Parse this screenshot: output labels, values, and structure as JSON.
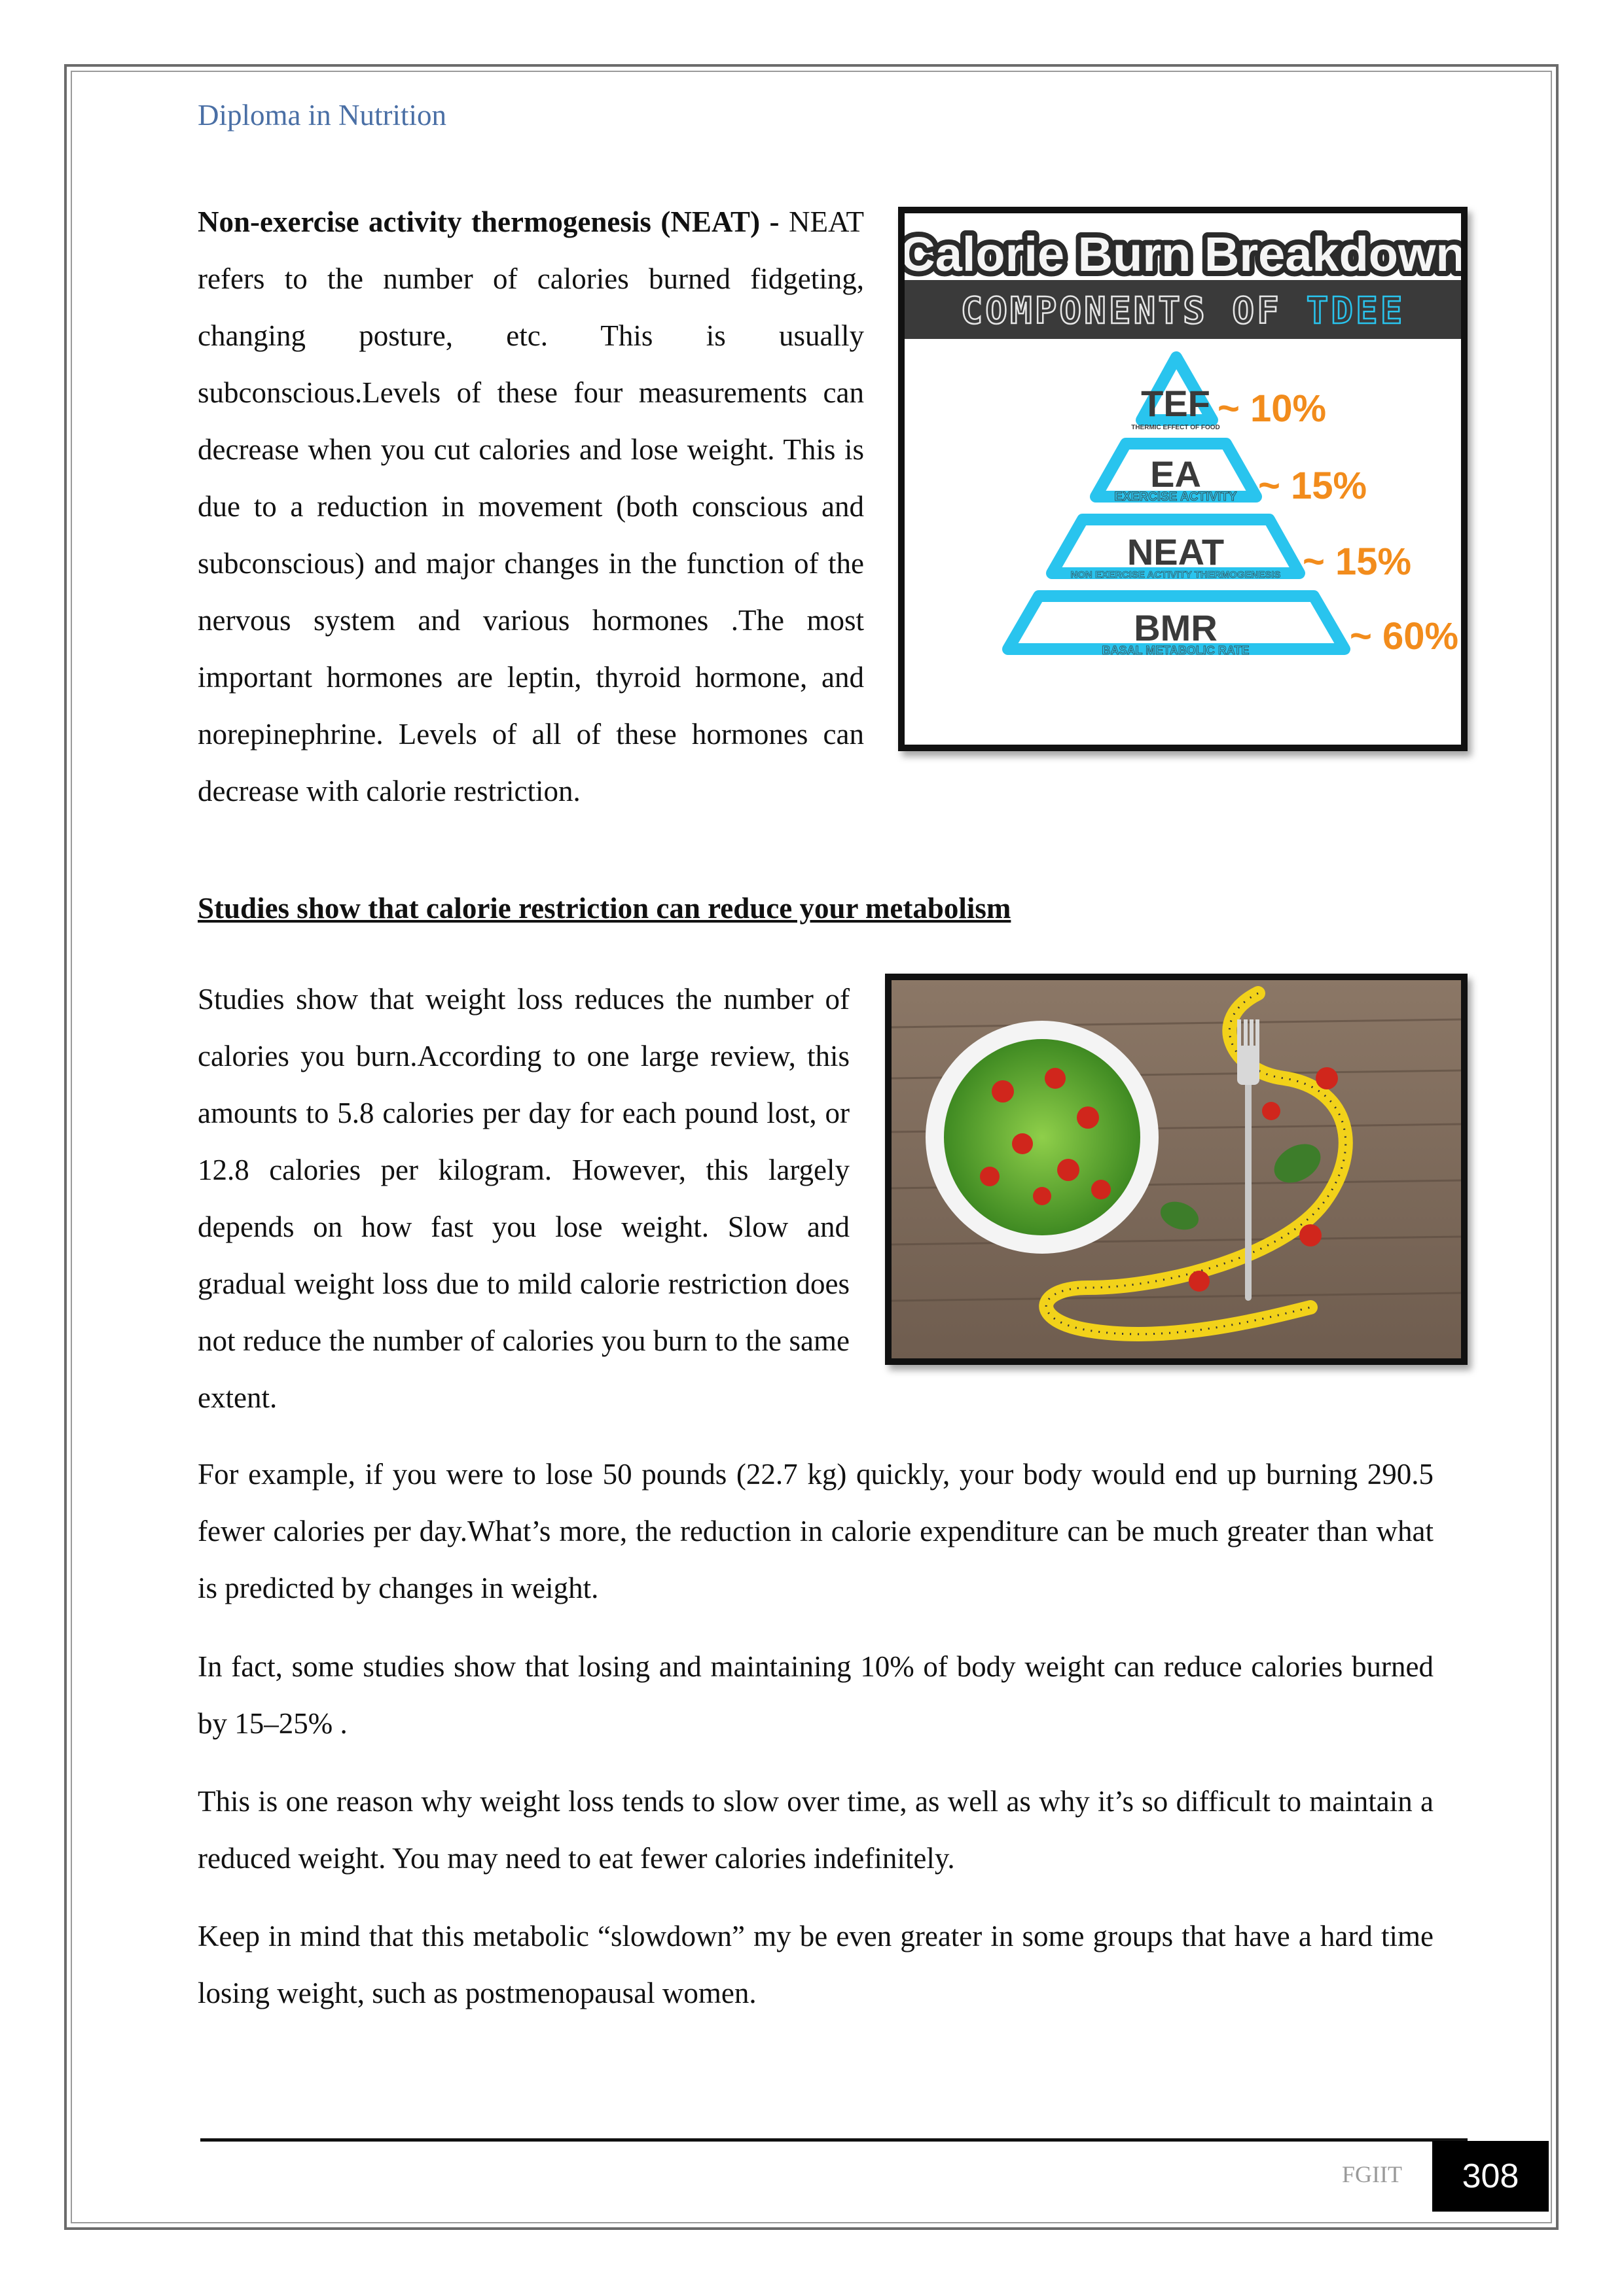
{
  "header": {
    "title": "Diploma in Nutrition"
  },
  "neat_paragraph": {
    "term": "Non-exercise activity thermogenesis (NEAT) -",
    "body": " NEAT refers to the number of calories burned fidgeting, changing posture, etc. This is usually subconscious.Levels of these four measurements can decrease when you cut calories and lose weight. This is due to a reduction in movement (both conscious and subconscious) and major changes in the function of the nervous system and various hormones .The most important hormones are leptin, thyroid hormone, and norepinephrine. Levels of all of these hormones can decrease with calorie restriction."
  },
  "tdee_figure": {
    "title": "Calorie Burn Breakdown",
    "subtitle_prefix": "COMPONENTS OF ",
    "subtitle_accent": "TDEE",
    "levels": [
      {
        "abbr": "TEF",
        "full": "THERMIC EFFECT OF FOOD",
        "pct_label": "~ 10%"
      },
      {
        "abbr": "EA",
        "full": "EXERCISE ACTIVITY",
        "pct_label": "~ 15%"
      },
      {
        "abbr": "NEAT",
        "full": "NON EXERCISE ACTIVITY THERMOGENESIS",
        "pct_label": "~ 15%"
      },
      {
        "abbr": "BMR",
        "full": "BASAL METABOLIC RATE",
        "pct_label": "~ 60%"
      }
    ],
    "colors": {
      "pyramid": "#29c4ee",
      "percent": "#f28c1c",
      "banner": "#3a3a3a",
      "banner_text": "#f2f2f2"
    }
  },
  "section_heading": "Studies show that calorie restriction can reduce your metabolism",
  "paragraphs": {
    "p1": "Studies show that weight loss reduces the number of calories you burn.According to one large review, this amounts to 5.8 calories per day for each pound lost, or 12.8 calories per kilogram. However, this largely depends on how fast you lose weight. Slow and gradual weight loss due to mild calorie restriction does not reduce the number of calories you burn to the same extent.",
    "p2": "For example, if you were to lose 50 pounds (22.7 kg) quickly, your body would end up burning 290.5 fewer calories per day.What’s more, the reduction in calorie expenditure can be much greater than what is predicted by changes in weight.",
    "p3": "In fact, some studies show that losing and maintaining 10% of body weight can reduce calories burned by 15–25% .",
    "p4": "This is one reason why weight loss tends to slow over time, as well as why it’s so difficult to maintain a reduced weight. You may need to eat fewer calories indefinitely.",
    "p5": "Keep in mind that this metabolic “slowdown” my be even greater in some groups that have a hard time losing weight, such as postmenopausal women."
  },
  "footer": {
    "label": "FGIIT",
    "page_number": "308"
  }
}
